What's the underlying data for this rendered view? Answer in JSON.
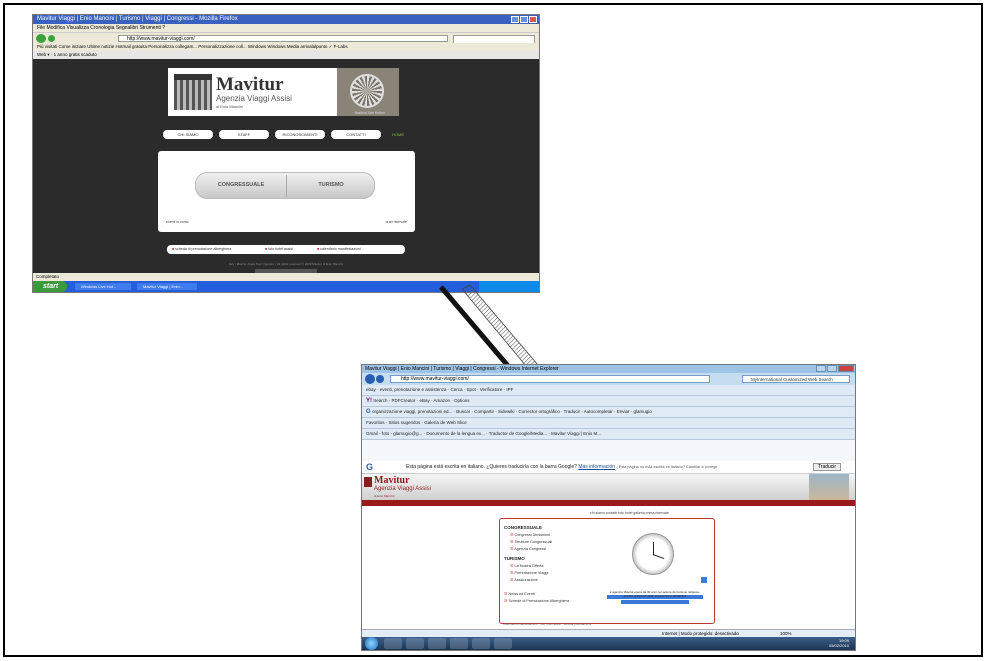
{
  "shot1": {
    "title": "Mavitur Viaggi | Enio Mancini | Turismo | Viaggi | Congressi - Mozilla Firefox",
    "menu": "File  Modifica  Visualizza  Cronologia  Segnalibri  Strumenti  ?",
    "url": "http://www.mavitur-viaggi.com/",
    "bookmarks": "Più visitati   Come iniziare   Ultime notizie   Hotmail gratuita   Personalizza collegam...   Personalizzazione coll...   Windows   Windows Media   arrivalalpunto   ✓ F-Labs",
    "toolbar": "Web ▾  ·  1 anno gratis scaduto",
    "brand": "Mavitur",
    "subtitle": "Agenzia Viaggi Assisi",
    "owner": "di Enio Mancini",
    "rose_caption": "Basilica San Rufino",
    "menu_buttons": [
      "CHI SIAMO",
      "STAFF",
      "RICONOSCIMENTI",
      "CONTATTI"
    ],
    "home": "HOME",
    "pill_left": "CONGRESSUALE",
    "pill_right": "TURISMO",
    "panel_left": "eventi in corso",
    "panel_right": "orari riservate",
    "links": [
      "scheda di prenotazione alberghiera",
      "foto hotel assisi",
      "calendario manifestazioni"
    ],
    "footer": "Italy | Mavitur Assisi Tour Operator - All rights reserved © 2009 Mavitur di Enio Mancini",
    "status": "Completato",
    "start": "start",
    "tasks": [
      "Windows Live Hot...",
      "Mavitur Viaggi | Enio..."
    ]
  },
  "shot2": {
    "title": "Mavitur Viaggi | Enio Mancini | Turismo | Viaggi | Congressi - Windows Internet Explorer",
    "url": "http://www.mavitur-viaggi.com/",
    "search_placeholder": "MyInternational Customized Web Search",
    "toolbar1": "ebay  ·  eventi, prenotazione e assistenza  ·  Cerca  ·  Spot  ·  Verificatore  ·  IPF",
    "toolbar2": "Search  ·  PDFCreator  ·  eBay  ·  Amazon  ·  Options",
    "toolbar3": "organizzazione viaggi, prenotazioni ed...  ·  Buscar  ·  Compartir  ·  Sidewiki  ·  Corrector ortográfico  ·  Traducir  ·  Autocompletar  ·  Enviar  ·  glamugio",
    "favorites": "Favoritos  ·  Sitios sugeridos  ·  Galería de Web Slice",
    "tabs": "Gmail - foto - glamugio@g...  ·  Documento de la lengua ex...  ·  Traductor de Google/Media...  ·  Mavitur Viaggi | Enio M...",
    "translate_prompt": "Esta página está escrita en italiano. ¿Quieres traducirla con la barra Google?",
    "translate_more": "Más información",
    "translate_options": "¿Esta página no está escrita en italiano?  Cambiar a corregir",
    "translate_button": "Traducir",
    "brand": "Mavitur",
    "subtitle": "Agenzia Viaggi Assisi",
    "owner": "di Enio Mancini",
    "top_links": "chi siamo   contatti   foto hotel   galleria   prima riservate",
    "sec1": "CONGRESSUALE",
    "items1": [
      "Congressi Dimissioni",
      "Strutture Congressuali",
      "Agenzia Congressi"
    ],
    "sec2": "TURISMO",
    "items2": [
      "La Nostra Offerta",
      "Prenotazione Viaggi",
      "Assicurazione"
    ],
    "items3": [
      "News ed Eventi",
      "Schede di Prenotazione Alberghiera"
    ],
    "sel_text": "L'agenzia Mavitur opera da 30 anni nel settore del turismo religioso, grande professionalità, esperienza e affidabilità",
    "bottom_row": "Calendario manifestazioni   ·   foto hotel assisi   ·   scheda prenotazione",
    "status": "Internet | Modo protegido: desactivado",
    "zoom": "100%",
    "clock_time": "19:09",
    "clock_date": "05/02/2010"
  }
}
